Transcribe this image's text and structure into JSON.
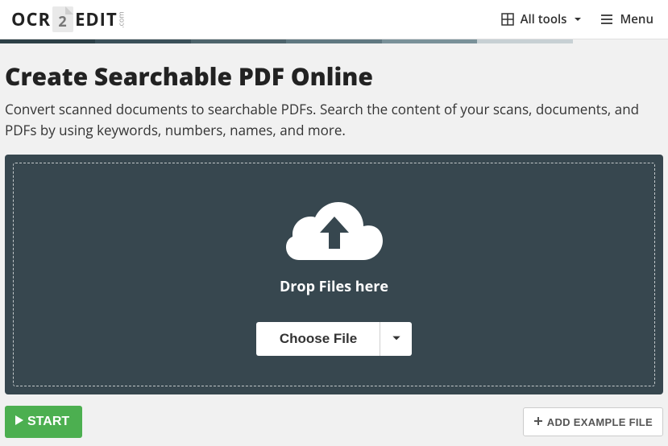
{
  "logo": {
    "part1": "OCR",
    "doc_number": "2",
    "part2": "EDIT",
    "suffix": ".com"
  },
  "nav": {
    "all_tools": "All tools",
    "menu": "Menu"
  },
  "page": {
    "title": "Create Searchable PDF Online",
    "subtitle": "Convert scanned documents to searchable PDFs. Search the content of your scans, documents, and PDFs by using keywords, numbers, names, and more."
  },
  "drop": {
    "text": "Drop Files here",
    "choose_label": "Choose File"
  },
  "actions": {
    "start": "START",
    "add_example": "ADD EXAMPLE FILE"
  }
}
